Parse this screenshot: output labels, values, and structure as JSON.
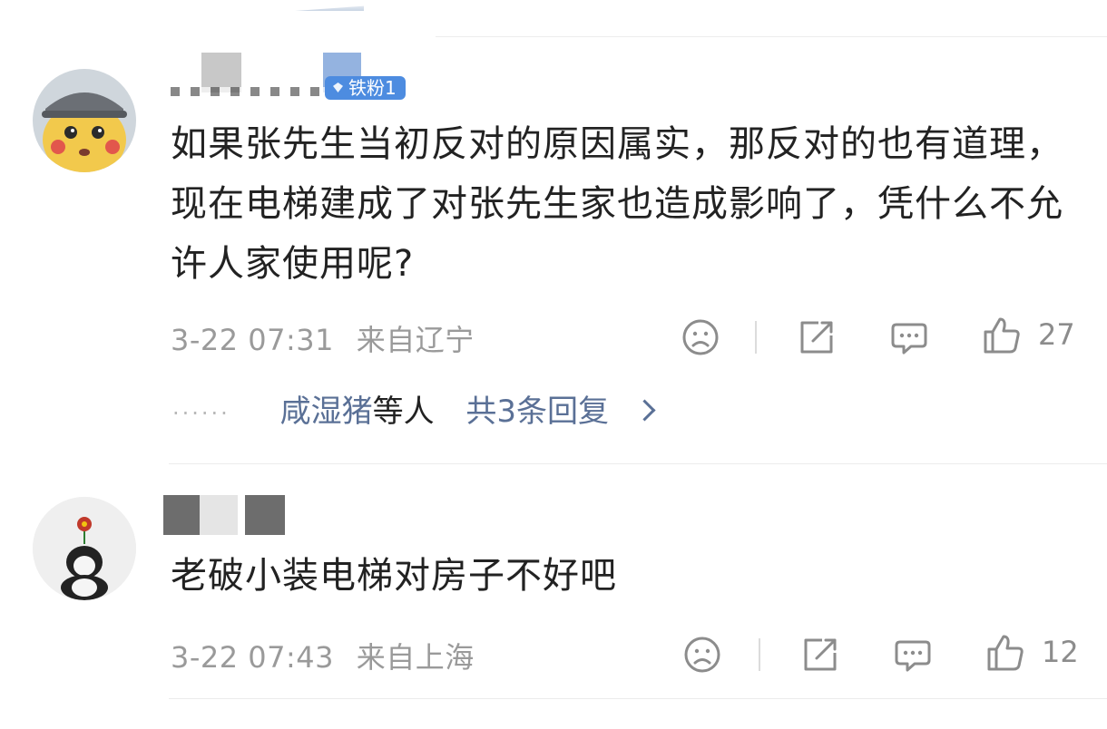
{
  "comments": [
    {
      "badge": "铁粉1",
      "text": "如果张先生当初反对的原因属实，那反对的也有道理，现在电梯建成了对张先生家也造成影响了，凭什么不允许人家使用呢?",
      "time": "3-22 07:31",
      "location": "来自辽宁",
      "likes": "27",
      "replies": {
        "users": "咸湿猪",
        "others": "等人",
        "count_label": "共3条回复"
      }
    },
    {
      "text": "老破小装电梯对房子不好吧",
      "time": "3-22 07:43",
      "location": "来自上海",
      "likes": "12"
    }
  ],
  "icons": {
    "dislike": "sad-face-icon",
    "share": "share-icon",
    "comment": "comment-bubble-icon",
    "like": "thumbs-up-icon",
    "more_replies": "chevron-right-icon"
  },
  "colors": {
    "badge": "#4d8ce0",
    "reply_link": "#5a7096",
    "meta_text": "#9a9a9a"
  }
}
